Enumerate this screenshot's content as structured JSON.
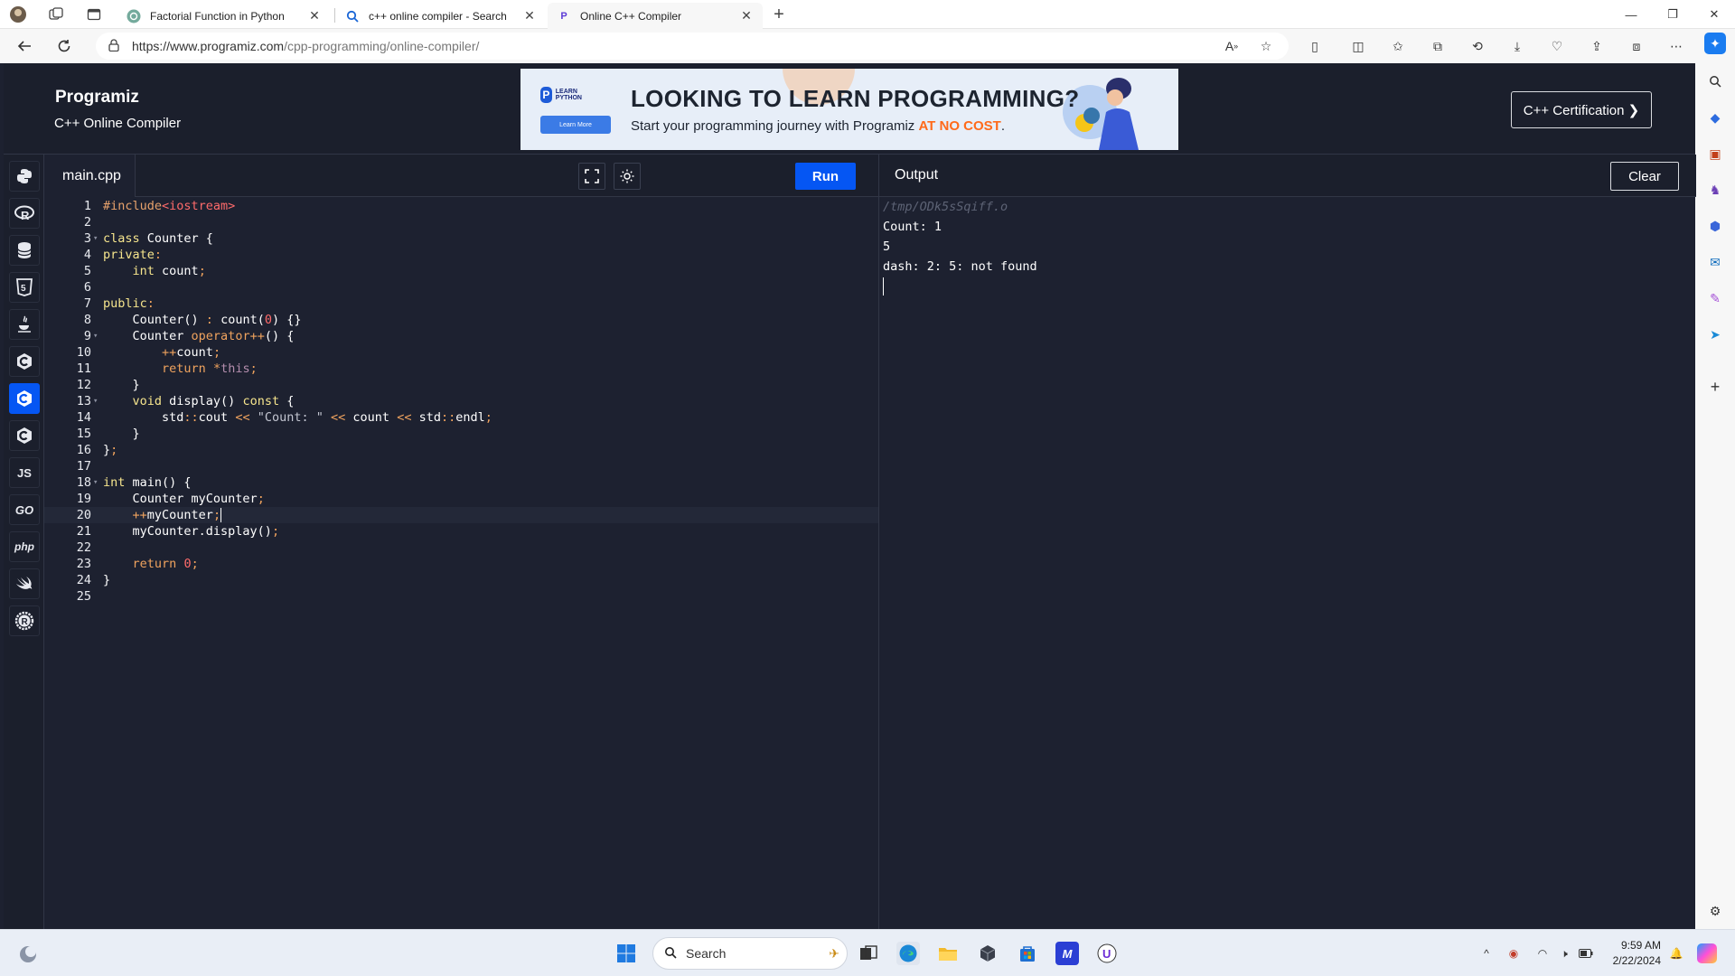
{
  "browser": {
    "tabs": [
      {
        "title": "Factorial Function in Python",
        "favicon": "chatgpt-icon",
        "active": false
      },
      {
        "title": "c++ online compiler - Search",
        "favicon": "search-icon",
        "active": false
      },
      {
        "title": "Online C++ Compiler",
        "favicon": "programiz-icon",
        "active": true
      }
    ],
    "url_host": "https://www.programiz.com",
    "url_path": "/cpp-programming/online-compiler/"
  },
  "site": {
    "logo": "Programiz",
    "subtitle": "C++ Online Compiler",
    "certification_button": "C++ Certification ❯",
    "ad": {
      "brand_line": "LEARN PYTHON",
      "learn_more": "Learn More",
      "headline": "LOOKING TO LEARN PROGRAMMING?",
      "subline_start": "Start your programming journey with Programiz ",
      "subline_highlight": "AT NO COST",
      "subline_end": "."
    }
  },
  "languages": [
    {
      "name": "python-icon",
      "label": "",
      "active": false
    },
    {
      "name": "r-icon",
      "label": "R",
      "active": false
    },
    {
      "name": "sql-icon",
      "label": "",
      "active": false
    },
    {
      "name": "html-icon",
      "label": "5",
      "active": false
    },
    {
      "name": "java-icon",
      "label": "",
      "active": false
    },
    {
      "name": "c-icon",
      "label": "C",
      "active": false
    },
    {
      "name": "cpp-icon",
      "label": "C",
      "active": true
    },
    {
      "name": "csharp-icon",
      "label": "C",
      "active": false
    },
    {
      "name": "javascript-icon",
      "label": "JS",
      "active": false
    },
    {
      "name": "go-icon",
      "label": "GO",
      "active": false
    },
    {
      "name": "php-icon",
      "label": "php",
      "active": false
    },
    {
      "name": "swift-icon",
      "label": "",
      "active": false
    },
    {
      "name": "rust-icon",
      "label": "R",
      "active": false
    }
  ],
  "editor": {
    "filename": "main.cpp",
    "run_label": "Run",
    "current_line": 20,
    "lines": [
      "#include<iostream>",
      "",
      "class Counter {",
      "private:",
      "    int count;",
      "",
      "public:",
      "    Counter() : count(0) {}",
      "    Counter operator++() {",
      "        ++count;",
      "        return *this;",
      "    }",
      "    void display() const {",
      "        std::cout << \"Count: \" << count << std::endl;",
      "    }",
      "};",
      "",
      "int main() {",
      "    Counter myCounter;",
      "    ++myCounter;",
      "    myCounter.display();",
      "",
      "    return 0;",
      "}",
      ""
    ],
    "fold_lines": [
      3,
      9,
      13,
      18
    ]
  },
  "output": {
    "title": "Output",
    "clear_label": "Clear",
    "lines": [
      "/tmp/ODk5sSqiff.o",
      "Count: 1",
      "5",
      "dash: 2: 5: not found"
    ]
  },
  "taskbar": {
    "search_placeholder": "Search",
    "time": "9:59 AM",
    "date": "2/22/2024"
  },
  "colors": {
    "accent": "#0556f3",
    "editor_bg": "#1d2130",
    "toolbar_bg": "#1b1f2c",
    "ad_highlight": "#ff6a1a"
  }
}
